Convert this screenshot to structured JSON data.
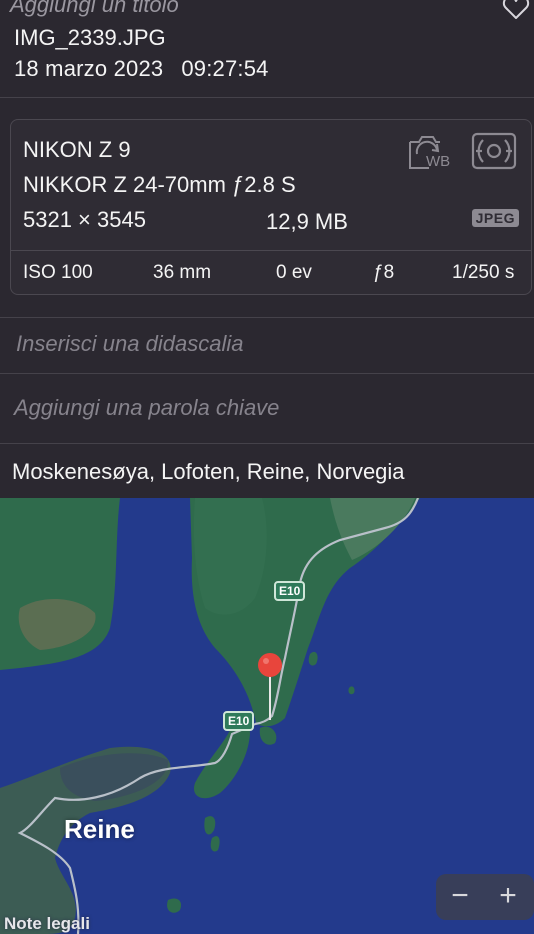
{
  "header": {
    "title_placeholder": "Aggiungi un titolo",
    "filename": "IMG_2339.JPG",
    "date": "18 marzo 2023",
    "time": "09:27:54",
    "favorite_icon": "heart-icon"
  },
  "info": {
    "camera": "NIKON Z 9",
    "lens": "NIKKOR Z 24-70mm ƒ2.8 S",
    "dimensions": "5321 × 3545",
    "file_size": "12,9 MB",
    "format_badge": "JPEG",
    "icons": [
      "white-balance-icon",
      "metering-icon"
    ],
    "exif": {
      "iso": "ISO 100",
      "focal_length": "36 mm",
      "exposure": "0 ev",
      "aperture": "ƒ8",
      "shutter": "1/250 s"
    }
  },
  "caption_placeholder": "Inserisci una didascalia",
  "keyword_placeholder": "Aggiungi una parola chiave",
  "location": "Moskenesøya, Lofoten, Reine, Norvegia",
  "map": {
    "place_label": "Reine",
    "road_label_1": "E10",
    "road_label_2": "E10",
    "legal_label": "Note legali",
    "zoom_out": "−",
    "zoom_in": "+",
    "colors": {
      "water": "#233a8c",
      "land": "#2f6b4c",
      "pin": "#e8453c"
    }
  }
}
